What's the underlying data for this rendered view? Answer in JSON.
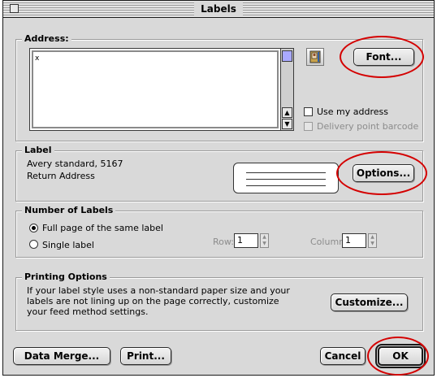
{
  "window": {
    "title": "Labels"
  },
  "address": {
    "group_label": "Address:",
    "text_value": "x",
    "font_button": "Font...",
    "use_my_address_label": "Use my address",
    "delivery_barcode_label": "Delivery point barcode",
    "icon": "address-book-icon"
  },
  "label": {
    "group_label": "Label",
    "line1": "Avery standard, 5167",
    "line2": "Return Address",
    "options_button": "Options..."
  },
  "number_of_labels": {
    "group_label": "Number of Labels",
    "full_page_label": "Full page of the same label",
    "single_label": "Single label",
    "row_label": "Row:",
    "row_value": "1",
    "column_label": "Column:",
    "column_value": "1"
  },
  "printing_options": {
    "group_label": "Printing Options",
    "line1": "If your label style uses a non-standard paper size and your",
    "line2": "labels are not lining up on the page correctly, customize",
    "line3": "your feed method settings.",
    "customize_button": "Customize..."
  },
  "footer": {
    "data_merge_button": "Data Merge...",
    "print_button": "Print...",
    "cancel_button": "Cancel",
    "ok_button": "OK"
  },
  "colors": {
    "highlight_oval": "#d40000",
    "dialog_bg": "#d9d9d9"
  }
}
